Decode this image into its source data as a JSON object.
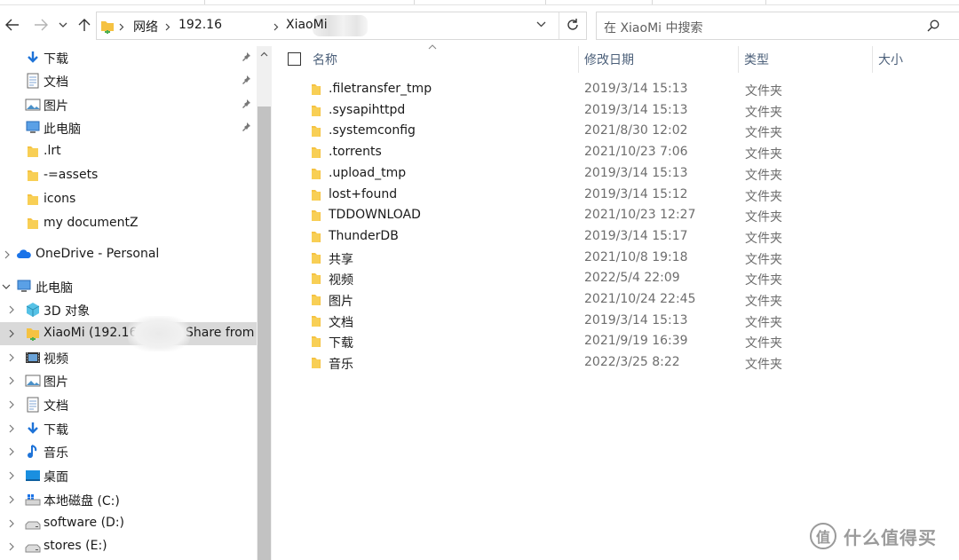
{
  "ribbon": {
    "tabs": [
      "",
      "",
      "",
      "",
      ""
    ]
  },
  "nav": {
    "back": "back",
    "forward": "forward",
    "recent": "recent-locations",
    "up": "up"
  },
  "address": {
    "crumbs": [
      "网络",
      "192.16",
      "XiaoMi"
    ]
  },
  "search": {
    "placeholder": "在 XiaoMi 中搜索"
  },
  "sidebar": {
    "quick_access": [
      {
        "label": "下载",
        "icon": "download-arrow-icon",
        "pinned": true
      },
      {
        "label": "文档",
        "icon": "document-icon",
        "pinned": true
      },
      {
        "label": "图片",
        "icon": "picture-icon",
        "pinned": true
      },
      {
        "label": "此电脑",
        "icon": "computer-icon",
        "pinned": true
      },
      {
        "label": ".lrt",
        "icon": "folder-icon",
        "pinned": false
      },
      {
        "label": "-=assets",
        "icon": "folder-icon",
        "pinned": false
      },
      {
        "label": "icons",
        "icon": "folder-icon",
        "pinned": false
      },
      {
        "label": "my documentZ",
        "icon": "folder-icon",
        "pinned": false
      }
    ],
    "onedrive": "OneDrive - Personal",
    "this_pc": "此电脑",
    "pc_items": [
      {
        "label": "3D 对象",
        "icon": "cube-3d-icon"
      },
      {
        "label": "XiaoMi (192.16",
        "label_tail": "Share from r",
        "icon": "network-folder-icon",
        "selected": true
      },
      {
        "label": "视频",
        "icon": "video-icon"
      },
      {
        "label": "图片",
        "icon": "picture-icon"
      },
      {
        "label": "文档",
        "icon": "document-icon"
      },
      {
        "label": "下载",
        "icon": "download-arrow-icon"
      },
      {
        "label": "音乐",
        "icon": "music-note-icon"
      },
      {
        "label": "桌面",
        "icon": "desktop-icon"
      },
      {
        "label": "本地磁盘 (C:)",
        "icon": "windows-drive-icon"
      },
      {
        "label": "software (D:)",
        "icon": "drive-icon"
      },
      {
        "label": "stores (E:)",
        "icon": "drive-icon"
      }
    ]
  },
  "columns": {
    "name": "名称",
    "modified": "修改日期",
    "type": "类型",
    "size": "大小"
  },
  "files": [
    {
      "name": ".filetransfer_tmp",
      "date": "2019/3/14 15:13",
      "type": "文件夹"
    },
    {
      "name": ".sysapihttpd",
      "date": "2019/3/14 15:13",
      "type": "文件夹"
    },
    {
      "name": ".systemconfig",
      "date": "2021/8/30 12:02",
      "type": "文件夹"
    },
    {
      "name": ".torrents",
      "date": "2021/10/23 7:06",
      "type": "文件夹"
    },
    {
      "name": ".upload_tmp",
      "date": "2019/3/14 15:13",
      "type": "文件夹"
    },
    {
      "name": "lost+found",
      "date": "2019/3/14 15:12",
      "type": "文件夹"
    },
    {
      "name": "TDDOWNLOAD",
      "date": "2021/10/23 12:27",
      "type": "文件夹"
    },
    {
      "name": "ThunderDB",
      "date": "2019/3/14 15:17",
      "type": "文件夹"
    },
    {
      "name": "共享",
      "date": "2021/10/8 19:18",
      "type": "文件夹"
    },
    {
      "name": "视频",
      "date": "2022/5/4 22:09",
      "type": "文件夹"
    },
    {
      "name": "图片",
      "date": "2021/10/24 22:45",
      "type": "文件夹"
    },
    {
      "name": "文档",
      "date": "2019/3/14 15:13",
      "type": "文件夹"
    },
    {
      "name": "下载",
      "date": "2021/9/19 16:39",
      "type": "文件夹"
    },
    {
      "name": "音乐",
      "date": "2022/3/25 8:22",
      "type": "文件夹"
    }
  ],
  "watermark": {
    "text": "什么值得买",
    "logo": "值"
  },
  "colors": {
    "folder": "#f5c242",
    "folder_dark": "#e3a21a",
    "accent": "#1a73e8",
    "selected_bg": "#d9d9d9"
  }
}
